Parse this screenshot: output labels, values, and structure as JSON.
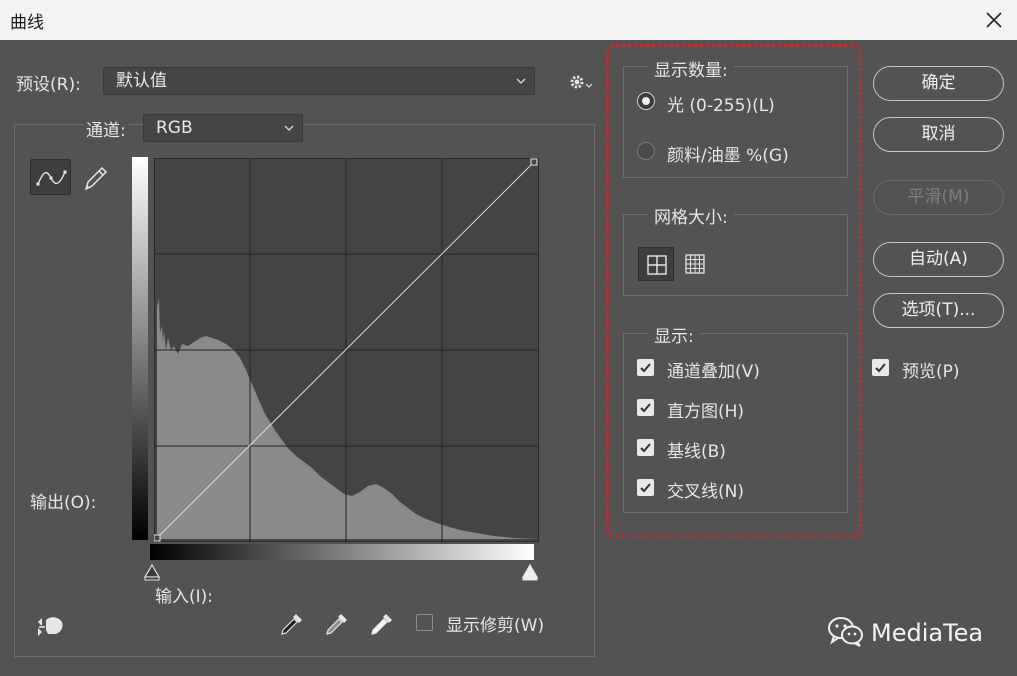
{
  "window": {
    "title": "曲线"
  },
  "preset": {
    "label": "预设(R):",
    "value": "默认值"
  },
  "channel": {
    "label": "通道:",
    "value": "RGB"
  },
  "output_label": "输出(O):",
  "input_label": "输入(I):",
  "show_clipping_label": "显示修剪(W)",
  "show_amount": {
    "legend": "显示数量:",
    "light_label": "光 (0-255)(L)",
    "pigment_label": "颜料/油墨 %(G)",
    "selected": "light"
  },
  "grid_size": {
    "legend": "网格大小:",
    "selected": "simple"
  },
  "display": {
    "legend": "显示:",
    "options": [
      {
        "label": "通道叠加(V)",
        "checked": true
      },
      {
        "label": "直方图(H)",
        "checked": true
      },
      {
        "label": "基线(B)",
        "checked": true
      },
      {
        "label": "交叉线(N)",
        "checked": true
      }
    ]
  },
  "buttons": {
    "ok": "确定",
    "cancel": "取消",
    "smooth": "平滑(M)",
    "auto": "自动(A)",
    "options": "选项(T)..."
  },
  "preview": {
    "label": "预览(P)",
    "checked": true
  },
  "watermark": {
    "text": "MediaTea"
  },
  "colors": {
    "highlight": "#d6242a",
    "panel": "#535353",
    "graph_bg": "#444444",
    "histogram": "#8a8a8a"
  }
}
